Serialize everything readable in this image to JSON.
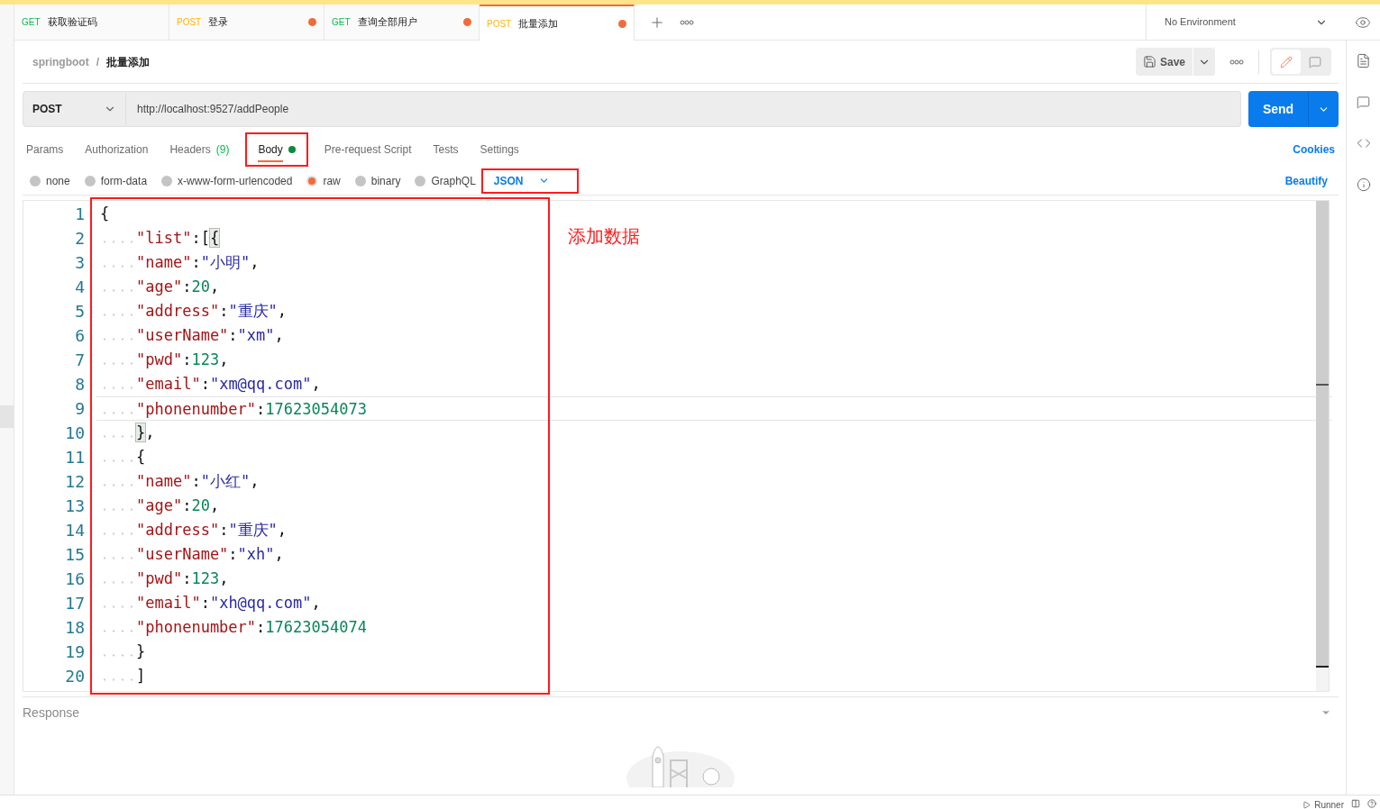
{
  "request_tabs": [
    {
      "method": "GET",
      "title": "获取验证码",
      "unsaved": false,
      "selected": false
    },
    {
      "method": "POST",
      "title": "登录",
      "unsaved": true,
      "selected": false
    },
    {
      "method": "GET",
      "title": "查询全部用户",
      "unsaved": true,
      "selected": false
    },
    {
      "method": "POST",
      "title": "批量添加",
      "unsaved": true,
      "selected": true
    }
  ],
  "environment": "No Environment",
  "breadcrumb": {
    "collection": "springboot",
    "separator": "/",
    "request": "批量添加"
  },
  "save_label": "Save",
  "mode_toggle": [
    {
      "kind": "edit",
      "selected": true
    },
    {
      "kind": "comment",
      "selected": false
    }
  ],
  "method": "POST",
  "url": "http://localhost:9527/addPeople",
  "send_label": "Send",
  "section_tabs": [
    {
      "label": "Params",
      "selected": false,
      "highlighted": false
    },
    {
      "label": "Authorization",
      "selected": false,
      "highlighted": false
    },
    {
      "label": "Headers",
      "count": "(9)",
      "selected": false,
      "highlighted": false
    },
    {
      "label": "Body",
      "dot": true,
      "selected": true,
      "highlighted": true
    },
    {
      "label": "Pre-request Script",
      "selected": false,
      "highlighted": false
    },
    {
      "label": "Tests",
      "selected": false,
      "highlighted": false
    },
    {
      "label": "Settings",
      "selected": false,
      "highlighted": false
    }
  ],
  "cookies_label": "Cookies",
  "body_types": [
    {
      "label": "none",
      "selected": false
    },
    {
      "label": "form-data",
      "selected": false
    },
    {
      "label": "x-www-form-urlencoded",
      "selected": false
    },
    {
      "label": "raw",
      "selected": true
    },
    {
      "label": "binary",
      "selected": false
    },
    {
      "label": "GraphQL",
      "selected": false
    }
  ],
  "format": {
    "label": "JSON",
    "highlighted": true
  },
  "beautify_label": "Beautify",
  "editor": {
    "highlighted": true,
    "lines": [
      {
        "number": "1",
        "current": false,
        "tokens": [
          {
            "kind": "punct",
            "text": "{"
          }
        ]
      },
      {
        "number": "2",
        "current": false,
        "tokens": [
          {
            "kind": "indent"
          },
          {
            "kind": "key",
            "text": "\"list\""
          },
          {
            "kind": "punct",
            "text": ":["
          },
          {
            "kind": "match",
            "text": "{"
          }
        ]
      },
      {
        "number": "3",
        "current": false,
        "tokens": [
          {
            "kind": "indent"
          },
          {
            "kind": "key",
            "text": "\"name\""
          },
          {
            "kind": "punct",
            "text": ":"
          },
          {
            "kind": "string",
            "text": "\"小明\""
          },
          {
            "kind": "punct",
            "text": ","
          }
        ]
      },
      {
        "number": "4",
        "current": false,
        "tokens": [
          {
            "kind": "indent"
          },
          {
            "kind": "key",
            "text": "\"age\""
          },
          {
            "kind": "punct",
            "text": ":"
          },
          {
            "kind": "number",
            "text": "20"
          },
          {
            "kind": "punct",
            "text": ","
          }
        ]
      },
      {
        "number": "5",
        "current": false,
        "tokens": [
          {
            "kind": "indent"
          },
          {
            "kind": "key",
            "text": "\"address\""
          },
          {
            "kind": "punct",
            "text": ":"
          },
          {
            "kind": "string",
            "text": "\"重庆\""
          },
          {
            "kind": "punct",
            "text": ","
          }
        ]
      },
      {
        "number": "6",
        "current": false,
        "tokens": [
          {
            "kind": "indent"
          },
          {
            "kind": "key",
            "text": "\"userName\""
          },
          {
            "kind": "punct",
            "text": ":"
          },
          {
            "kind": "string",
            "text": "\"xm\""
          },
          {
            "kind": "punct",
            "text": ","
          }
        ]
      },
      {
        "number": "7",
        "current": false,
        "tokens": [
          {
            "kind": "indent"
          },
          {
            "kind": "key",
            "text": "\"pwd\""
          },
          {
            "kind": "punct",
            "text": ":"
          },
          {
            "kind": "number",
            "text": "123"
          },
          {
            "kind": "punct",
            "text": ","
          }
        ]
      },
      {
        "number": "8",
        "current": false,
        "tokens": [
          {
            "kind": "indent"
          },
          {
            "kind": "key",
            "text": "\"email\""
          },
          {
            "kind": "punct",
            "text": ":"
          },
          {
            "kind": "string",
            "text": "\"xm@qq.com\""
          },
          {
            "kind": "punct",
            "text": ","
          }
        ]
      },
      {
        "number": "9",
        "current": true,
        "tokens": [
          {
            "kind": "indent"
          },
          {
            "kind": "key",
            "text": "\"phonenumber\""
          },
          {
            "kind": "punct",
            "text": ":"
          },
          {
            "kind": "number",
            "text": "17623054073"
          }
        ]
      },
      {
        "number": "10",
        "current": false,
        "tokens": [
          {
            "kind": "indent"
          },
          {
            "kind": "match",
            "text": "}"
          },
          {
            "kind": "punct",
            "text": ","
          }
        ]
      },
      {
        "number": "11",
        "current": false,
        "tokens": [
          {
            "kind": "indent"
          },
          {
            "kind": "punct",
            "text": "{"
          }
        ]
      },
      {
        "number": "12",
        "current": false,
        "tokens": [
          {
            "kind": "indent"
          },
          {
            "kind": "key",
            "text": "\"name\""
          },
          {
            "kind": "punct",
            "text": ":"
          },
          {
            "kind": "string",
            "text": "\"小红\""
          },
          {
            "kind": "punct",
            "text": ","
          }
        ]
      },
      {
        "number": "13",
        "current": false,
        "tokens": [
          {
            "kind": "indent"
          },
          {
            "kind": "key",
            "text": "\"age\""
          },
          {
            "kind": "punct",
            "text": ":"
          },
          {
            "kind": "number",
            "text": "20"
          },
          {
            "kind": "punct",
            "text": ","
          }
        ]
      },
      {
        "number": "14",
        "current": false,
        "tokens": [
          {
            "kind": "indent"
          },
          {
            "kind": "key",
            "text": "\"address\""
          },
          {
            "kind": "punct",
            "text": ":"
          },
          {
            "kind": "string",
            "text": "\"重庆\""
          },
          {
            "kind": "punct",
            "text": ","
          }
        ]
      },
      {
        "number": "15",
        "current": false,
        "tokens": [
          {
            "kind": "indent"
          },
          {
            "kind": "key",
            "text": "\"userName\""
          },
          {
            "kind": "punct",
            "text": ":"
          },
          {
            "kind": "string",
            "text": "\"xh\""
          },
          {
            "kind": "punct",
            "text": ","
          }
        ]
      },
      {
        "number": "16",
        "current": false,
        "tokens": [
          {
            "kind": "indent"
          },
          {
            "kind": "key",
            "text": "\"pwd\""
          },
          {
            "kind": "punct",
            "text": ":"
          },
          {
            "kind": "number",
            "text": "123"
          },
          {
            "kind": "punct",
            "text": ","
          }
        ]
      },
      {
        "number": "17",
        "current": false,
        "tokens": [
          {
            "kind": "indent"
          },
          {
            "kind": "key",
            "text": "\"email\""
          },
          {
            "kind": "punct",
            "text": ":"
          },
          {
            "kind": "string",
            "text": "\"xh@qq.com\""
          },
          {
            "kind": "punct",
            "text": ","
          }
        ]
      },
      {
        "number": "18",
        "current": false,
        "tokens": [
          {
            "kind": "indent"
          },
          {
            "kind": "key",
            "text": "\"phonenumber\""
          },
          {
            "kind": "punct",
            "text": ":"
          },
          {
            "kind": "number",
            "text": "17623054074"
          }
        ]
      },
      {
        "number": "19",
        "current": false,
        "tokens": [
          {
            "kind": "indent"
          },
          {
            "kind": "punct",
            "text": "}"
          }
        ]
      },
      {
        "number": "20",
        "current": false,
        "tokens": [
          {
            "kind": "indent"
          },
          {
            "kind": "punct",
            "text": "]"
          }
        ]
      }
    ]
  },
  "annotation": "添加数据",
  "response_label": "Response",
  "status_bar": {
    "runner": "Runner"
  }
}
